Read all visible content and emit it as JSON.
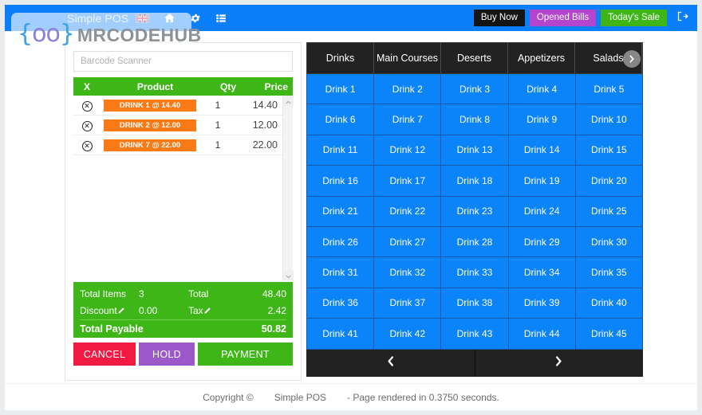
{
  "header": {
    "brand_title": "Simple POS",
    "flag_icon": "uk-flag-icon",
    "home_icon": "home-icon",
    "settings_icon": "gear-icon",
    "list_icon": "list-icon",
    "buy_now_label": "Buy Now",
    "opened_bills_label": "Opened Bills",
    "todays_sale_label": "Today's Sale",
    "logout_icon": "logout-icon",
    "colors": {
      "bar": "#0b7ffa",
      "buy_now": "#141414",
      "opened_bills": "#b545cf",
      "todays_sale": "#3fb618"
    }
  },
  "watermark": {
    "mark_left": "{",
    "mark_oo": "oo",
    "mark_right": "}",
    "text": "MRCODEHUB"
  },
  "cart": {
    "barcode_placeholder": "Barcode Scanner",
    "barcode_value": "",
    "columns": [
      "X",
      "Product",
      "Qty",
      "Price"
    ],
    "rows": [
      {
        "delete_icon": "remove-circle-icon",
        "product": "DRINK 1 @ 14.40",
        "qty": "1",
        "price": "14.40"
      },
      {
        "delete_icon": "remove-circle-icon",
        "product": "DRINK 2 @ 12.00",
        "qty": "1",
        "price": "12.00"
      },
      {
        "delete_icon": "remove-circle-icon",
        "product": "DRINK 7 @ 22.00",
        "qty": "1",
        "price": "22.00"
      }
    ],
    "scrollbar_up_icon": "chevron-up-icon",
    "scrollbar_down_icon": "chevron-down-icon",
    "totals": {
      "total_items_label": "Total Items",
      "total_items_value": "3",
      "total_label": "Total",
      "total_value": "48.40",
      "discount_label": "Discount",
      "discount_edit_icon": "pencil-icon",
      "discount_value": "0.00",
      "tax_label": "Tax",
      "tax_edit_icon": "pencil-icon",
      "tax_value": "2.42",
      "total_payable_label": "Total Payable",
      "total_payable_value": "50.82"
    },
    "actions": {
      "cancel_label": "CANCEL",
      "hold_label": "HOLD",
      "payment_label": "PAYMENT"
    },
    "colors": {
      "totals_bg": "#3fb618",
      "product_badge": "#fa7a16",
      "cancel": "#f01a43",
      "hold": "#9b59c9",
      "payment": "#3fb618"
    }
  },
  "products": {
    "categories": [
      {
        "label": "Drinks",
        "active": true
      },
      {
        "label": "Main Courses",
        "active": false
      },
      {
        "label": "Deserts",
        "active": false
      },
      {
        "label": "Appetizers",
        "active": false
      },
      {
        "label": "Salads",
        "active": false
      }
    ],
    "scroll_right_icon": "chevron-right-icon",
    "items": [
      "Drink 1",
      "Drink 2",
      "Drink 3",
      "Drink 4",
      "Drink 5",
      "Drink 6",
      "Drink 7",
      "Drink 8",
      "Drink 9",
      "Drink 10",
      "Drink 11",
      "Drink 12",
      "Drink 13",
      "Drink 14",
      "Drink 15",
      "Drink 16",
      "Drink 17",
      "Drink 18",
      "Drink 19",
      "Drink 20",
      "Drink 21",
      "Drink 22",
      "Drink 23",
      "Drink 24",
      "Drink 25",
      "Drink 26",
      "Drink 27",
      "Drink 28",
      "Drink 29",
      "Drink 30",
      "Drink 31",
      "Drink 32",
      "Drink 33",
      "Drink 34",
      "Drink 35",
      "Drink 36",
      "Drink 37",
      "Drink 38",
      "Drink 39",
      "Drink 40",
      "Drink 41",
      "Drink 42",
      "Drink 43",
      "Drink 44",
      "Drink 45"
    ],
    "pager": {
      "prev_icon": "chevron-left-icon",
      "next_icon": "chevron-right-icon"
    },
    "colors": {
      "tab_bar": "#222222",
      "cell": "#0b84fa",
      "cell_border": "#1757a8"
    }
  },
  "footer": {
    "copyright": "Copyright ©",
    "app_name": "Simple POS",
    "render_time": "- Page rendered in 0.3750 seconds."
  }
}
